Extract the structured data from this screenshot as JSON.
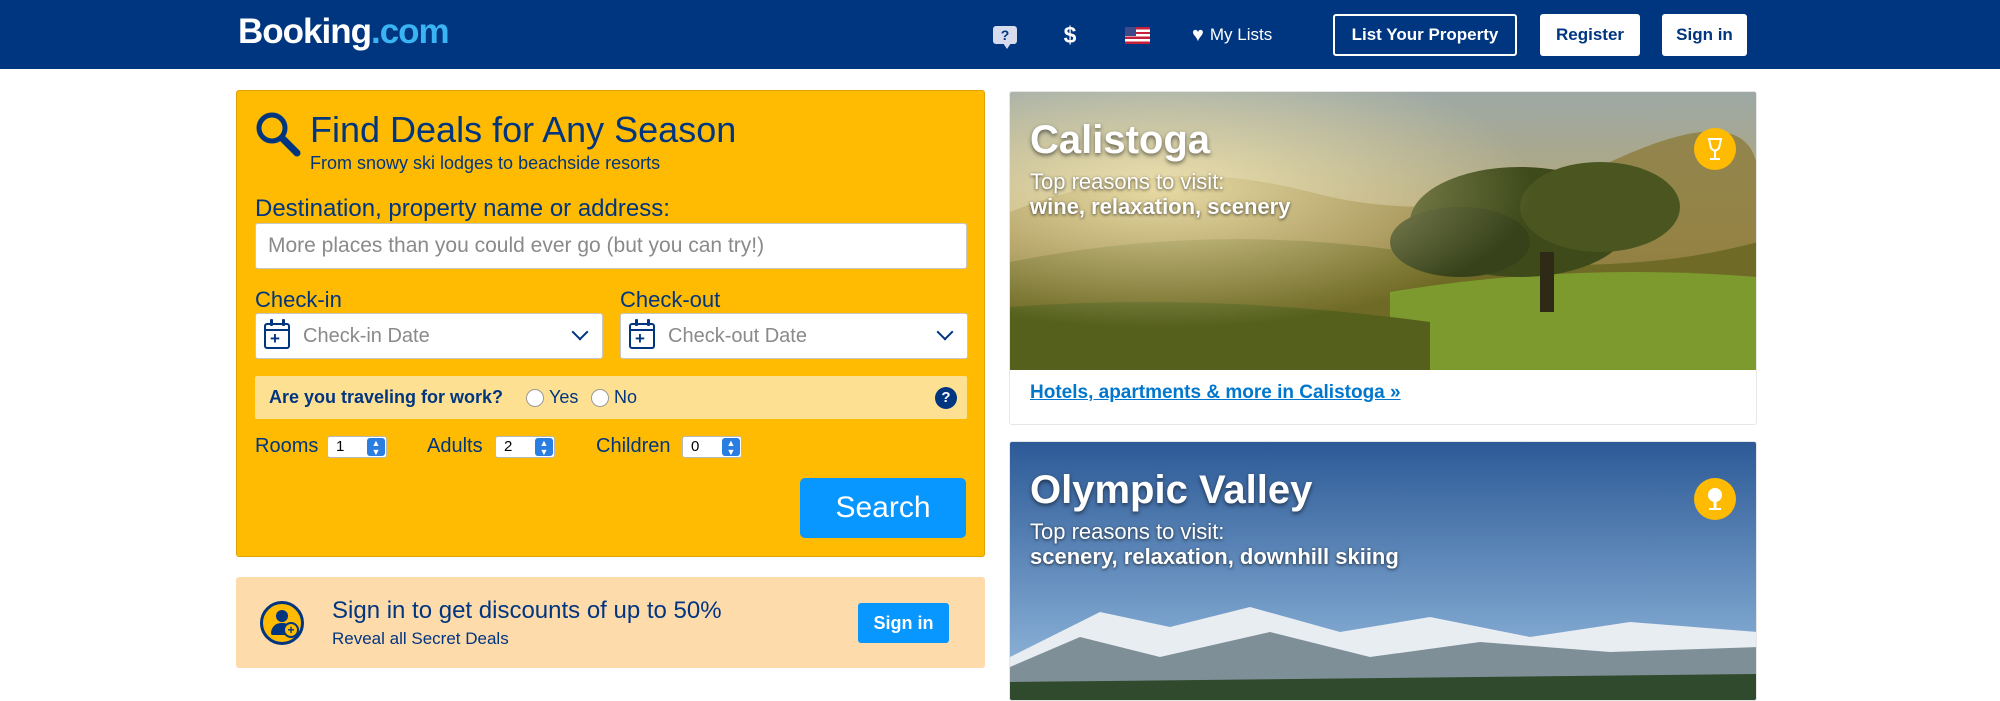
{
  "header": {
    "logo_main": "Booking",
    "logo_suffix": ".com",
    "help_icon_glyph": "?",
    "currency": "$",
    "my_lists": "My Lists",
    "list_property": "List Your Property",
    "register": "Register",
    "sign_in": "Sign in"
  },
  "search": {
    "title": "Find Deals for Any Season",
    "subtitle": "From snowy ski lodges to beachside resorts",
    "destination_label": "Destination, property name or address:",
    "destination_placeholder": "More places than you could ever go (but you can try!)",
    "checkin_label": "Check-in",
    "checkin_placeholder": "Check-in Date",
    "checkout_label": "Check-out",
    "checkout_placeholder": "Check-out Date",
    "work_question": "Are you traveling for work?",
    "work_yes": "Yes",
    "work_no": "No",
    "help_badge": "?",
    "rooms_label": "Rooms",
    "rooms_value": "1",
    "adults_label": "Adults",
    "adults_value": "2",
    "children_label": "Children",
    "children_value": "0",
    "search_button": "Search"
  },
  "deals": {
    "title": "Sign in to get discounts of up to 50%",
    "subtitle": "Reveal all Secret Deals",
    "button": "Sign in"
  },
  "destinations": [
    {
      "name": "Calistoga",
      "reason_label": "Top reasons to visit:",
      "reasons": "wine, relaxation, scenery",
      "link": "Hotels, apartments & more in Calistoga »",
      "badge_icon": "wine-glass-icon"
    },
    {
      "name": "Olympic Valley",
      "reason_label": "Top reasons to visit:",
      "reasons": "scenery, relaxation, downhill skiing",
      "badge_icon": "tree-icon"
    }
  ],
  "colors": {
    "header_bg": "#003580",
    "search_bg": "#febb02",
    "primary_button": "#0896ff",
    "deal_bg": "#fedbab",
    "link": "#0077cc"
  }
}
